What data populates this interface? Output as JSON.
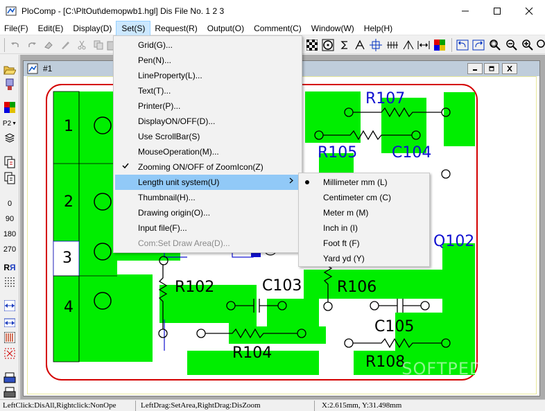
{
  "window": {
    "title": "PloComp - [C:\\PltOut\\demopwb1.hgl] Dis File No. 1 2 3"
  },
  "menubar": [
    {
      "label": "File(F)"
    },
    {
      "label": "Edit(E)"
    },
    {
      "label": "Display(D)"
    },
    {
      "label": "Set(S)"
    },
    {
      "label": "Request(R)"
    },
    {
      "label": "Output(O)"
    },
    {
      "label": "Comment(C)"
    },
    {
      "label": "Window(W)"
    },
    {
      "label": "Help(H)"
    }
  ],
  "set_menu": {
    "items": [
      {
        "label": "Grid(G)..."
      },
      {
        "label": "Pen(N)..."
      },
      {
        "label": "LineProperty(L)..."
      },
      {
        "label": "Text(T)..."
      },
      {
        "label": "Printer(P)..."
      },
      {
        "label": "DisplayON/OFF(D)..."
      },
      {
        "label": "Use ScrollBar(S)"
      },
      {
        "label": "MouseOperation(M)..."
      },
      {
        "label": "Zooming ON/OFF of ZoomIcon(Z)",
        "checked": true
      },
      {
        "label": "Length unit system(U)",
        "has_submenu": true,
        "highlighted": true
      },
      {
        "label": "Thumbnail(H)..."
      },
      {
        "label": "Drawing origin(O)..."
      },
      {
        "label": "Input file(F)..."
      },
      {
        "label": "Com:Set Draw Area(D)...",
        "disabled": true
      }
    ]
  },
  "length_submenu": {
    "items": [
      {
        "label": "Millimeter mm (L)",
        "selected": true
      },
      {
        "label": "Centimeter cm (C)"
      },
      {
        "label": "Meter m (M)"
      },
      {
        "label": "Inch in (I)"
      },
      {
        "label": "Foot ft (F)"
      },
      {
        "label": "Yard yd (Y)"
      }
    ]
  },
  "left_toolbar": {
    "pen_label": "P2",
    "angles": [
      "0",
      "90",
      "180",
      "270"
    ],
    "rotate_label": "R"
  },
  "child_window": {
    "title": "#1"
  },
  "drawing": {
    "slot_labels": [
      "1",
      "2",
      "3",
      "4"
    ],
    "component_labels": [
      "R107",
      "R105",
      "C104",
      "Q102",
      "R102",
      "C103",
      "R106",
      "C105",
      "R104",
      "R108"
    ]
  },
  "statusbar": {
    "left": "LeftClick:DisAll,Rightclick:NonOpe",
    "middle": "LeftDrag:SetArea,RightDrag:DisZoom",
    "coords": "X:2.615mm, Y:31.498mm"
  },
  "watermark": "SOFTPEDIA®",
  "colors": {
    "pcb_green": "#00ee00",
    "trace_blue": "#1010d0",
    "outline_red": "#d40000",
    "menu_highlight": "#91c9f7"
  }
}
